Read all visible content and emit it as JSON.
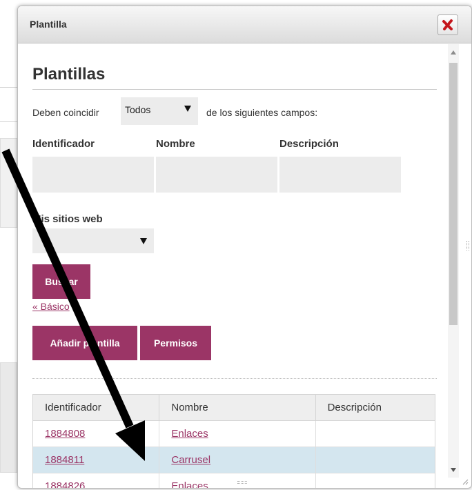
{
  "dialog": {
    "title": "Plantilla",
    "close_icon": "close-x-icon"
  },
  "page": {
    "heading": "Plantillas",
    "match_prefix": "Deben coincidir",
    "match_value": "Todos",
    "match_suffix": "de los siguientes campos:",
    "fields": {
      "identificador_label": "Identificador",
      "nombre_label": "Nombre",
      "descripcion_label": "Descripción",
      "identificador_value": "",
      "nombre_value": "",
      "descripcion_value": ""
    },
    "sites_label": "Mis sitios web",
    "sites_value": "",
    "search_button": "Buscar",
    "basic_link": "« Básico",
    "add_button": "Añadir plantilla",
    "permissions_button": "Permisos"
  },
  "table": {
    "headers": [
      "Identificador",
      "Nombre",
      "Descripción"
    ],
    "rows": [
      {
        "id": "1884808",
        "name": "Enlaces",
        "desc": ""
      },
      {
        "id": "1884811",
        "name": "Carrusel",
        "desc": ""
      },
      {
        "id": "1884826",
        "name": "Enlaces",
        "desc": ""
      }
    ]
  },
  "colors": {
    "accent": "#9b3566",
    "selected_row": "#d4e6ef",
    "arrow": "#000000"
  }
}
